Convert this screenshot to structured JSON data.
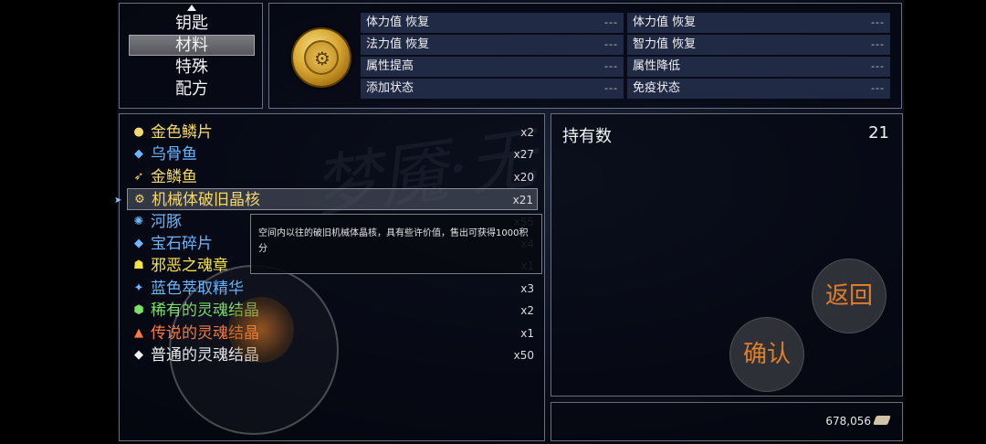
{
  "categories": [
    {
      "label": "钥匙"
    },
    {
      "label": "材料",
      "selected": true
    },
    {
      "label": "特殊"
    },
    {
      "label": "配方"
    }
  ],
  "detail": {
    "icon": "gold-gear-coin-icon",
    "stats_left": [
      {
        "label": "体力值 恢复",
        "value": "---"
      },
      {
        "label": "法力值 恢复",
        "value": "---"
      },
      {
        "label": "属性提高",
        "value": "---"
      },
      {
        "label": "添加状态",
        "value": "---"
      }
    ],
    "stats_right": [
      {
        "label": "体力值 恢复",
        "value": "---"
      },
      {
        "label": "智力值 恢复",
        "value": "---"
      },
      {
        "label": "属性降低",
        "value": "---"
      },
      {
        "label": "免疫状态",
        "value": "---"
      }
    ]
  },
  "items": [
    {
      "name": "金色鳞片",
      "count": "x2",
      "color": "#f5d86a",
      "icon": "gold-scale-icon"
    },
    {
      "name": "乌骨鱼",
      "count": "x27",
      "color": "#6ab6ff",
      "icon": "fish-icon"
    },
    {
      "name": "金鳞鱼",
      "count": "x20",
      "color": "#f5d86a",
      "icon": "gold-fish-icon"
    },
    {
      "name": "机械体破旧晶核",
      "count": "x21",
      "color": "#f5d86a",
      "icon": "gear-core-icon",
      "selected": true
    },
    {
      "name": "河豚",
      "count": "x55",
      "color": "#6ab6ff",
      "icon": "pufferfish-icon"
    },
    {
      "name": "宝石碎片",
      "count": "x4",
      "color": "#6ab6ff",
      "icon": "gem-icon"
    },
    {
      "name": "邪恶之魂章",
      "count": "x1",
      "color": "#f5e34a",
      "icon": "evil-emblem-icon"
    },
    {
      "name": "蓝色萃取精华",
      "count": "x3",
      "color": "#6ab6ff",
      "icon": "blue-essence-icon"
    },
    {
      "name": "稀有的灵魂结晶",
      "count": "x2",
      "color": "#7ee06a",
      "icon": "green-crystal-icon"
    },
    {
      "name": "传说的灵魂结晶",
      "count": "x1",
      "color": "#ff7a3a",
      "icon": "orange-crystal-icon"
    },
    {
      "name": "普通的灵魂结晶",
      "count": "x50",
      "color": "#f2f2f2",
      "icon": "white-crystal-icon"
    }
  ],
  "tooltip": {
    "text": "空间内以往的破旧机械体晶核，具有些许价值，售出可获得1000积分"
  },
  "holding": {
    "label": "持有数",
    "value": "21"
  },
  "money": {
    "value": "678,056",
    "icon": "money-icon"
  },
  "buttons": {
    "return": "返回",
    "confirm": "确认"
  },
  "colors": {
    "selected_bg": "#6a6c72",
    "stat_bg": "#263048",
    "button_text": "#ff8c28"
  }
}
